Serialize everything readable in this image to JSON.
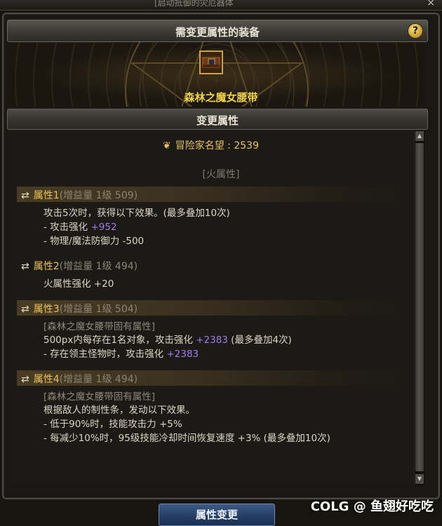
{
  "window": {
    "title": "[启动抵御的灾厄器体",
    "close_glyph": "×"
  },
  "header": {
    "title": "需变更属性的装备",
    "help_glyph": "?"
  },
  "item": {
    "name": "森林之魔女腰带"
  },
  "section": {
    "title": "变更属性"
  },
  "fame": {
    "label": "冒险家名望 : 2539"
  },
  "element": {
    "label": "[火属性]"
  },
  "attributes": [
    {
      "name": "属性1",
      "level": "(增益量 1级 509)",
      "lines": [
        {
          "text": "攻击5次时，获得以下效果。(最多叠加10次)"
        },
        {
          "text": "- 攻击强化 ",
          "value": "+952"
        },
        {
          "text": "- 物理/魔法防御力 -500"
        }
      ]
    },
    {
      "name": "属性2",
      "level": "(增益量 1级 494)",
      "lines": [
        {
          "text": "火属性强化 +20"
        }
      ]
    },
    {
      "name": "属性3",
      "level": "(增益量 1级 504)",
      "lines": [
        {
          "text": "[森林之魔女腰带固有属性]"
        },
        {
          "text": "500px内每存在1名对象，攻击强化 ",
          "value": "+2383",
          "suffix": " (最多叠加4次)"
        },
        {
          "text": "- 存在领主怪物时，攻击强化 ",
          "value": "+2383"
        }
      ]
    },
    {
      "name": "属性4",
      "level": "(增益量 1级 494)",
      "lines": [
        {
          "text": "[森林之魔女腰带固有属性]"
        },
        {
          "text": "根据敌人的制性条，发动以下效果。"
        },
        {
          "text": "- 低于90%时，技能攻击力 +5%"
        },
        {
          "text": "- 每减少10%时，95级技能冷却时间恢复速度 +3% (最多叠加10次)"
        }
      ]
    }
  ],
  "footer": {
    "button_label": "属性变更"
  },
  "watermark": {
    "text": "COLG @ 鱼翅好吃吃"
  },
  "icons": {
    "shuffle": "shuffle-icon",
    "emblem": "fame-emblem-icon",
    "help": "help-icon"
  },
  "colors": {
    "gold": "#e9c35a",
    "purple": "#a07cf0",
    "button": "#263f66"
  }
}
